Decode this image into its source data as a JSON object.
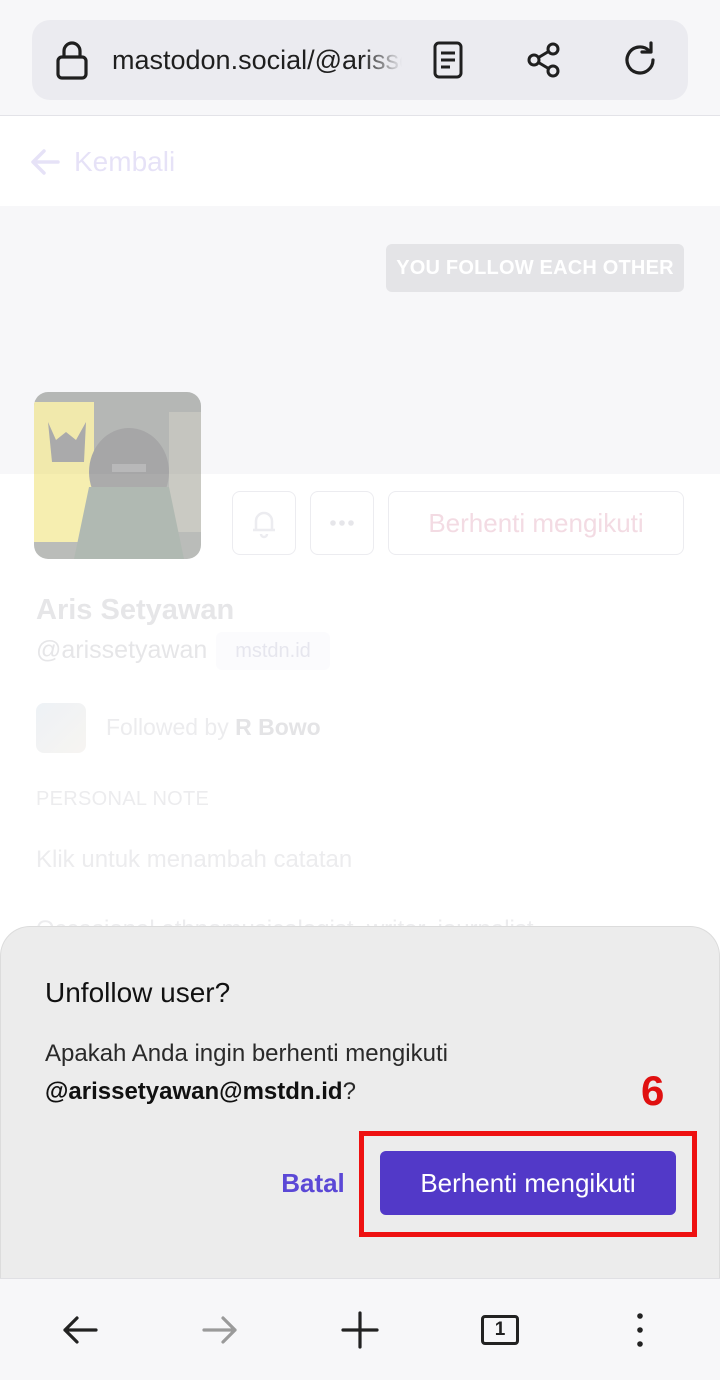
{
  "browser": {
    "url": "mastodon.social/@arissetyawan",
    "icons": [
      "lock-icon",
      "reader-mode-icon",
      "share-icon",
      "reload-icon"
    ]
  },
  "page": {
    "back_label": "Kembali",
    "relationship_badge": "YOU FOLLOW EACH OTHER",
    "unfollow_label": "Berhenti mengikuti",
    "display_name": "Aris Setyawan",
    "handle": "@arissetyawan",
    "domain": "mstdn.id",
    "followed_by_prefix": "Followed by",
    "followed_by_name": "R Bowo",
    "personal_note_label": "PERSONAL NOTE",
    "personal_note_placeholder": "Klik untuk menambah catatan",
    "bio": "Occasional ethnomusicologist, writer, journalist"
  },
  "dialog": {
    "title": "Unfollow user?",
    "message": "Apakah Anda ingin berhenti mengikuti",
    "account": "@arissetyawan@mstdn.id",
    "message_suffix": "?",
    "cancel_label": "Batal",
    "confirm_label": "Berhenti mengikuti",
    "step_number": "6"
  },
  "bottom_nav": {
    "tab_count": "1",
    "icons": [
      "back-arrow-icon",
      "forward-arrow-icon",
      "new-tab-icon",
      "tabs-icon",
      "menu-icon"
    ]
  },
  "colors": {
    "accent": "#5239c8",
    "highlight": "#ee1111",
    "cancel_text": "#5b48d6"
  }
}
